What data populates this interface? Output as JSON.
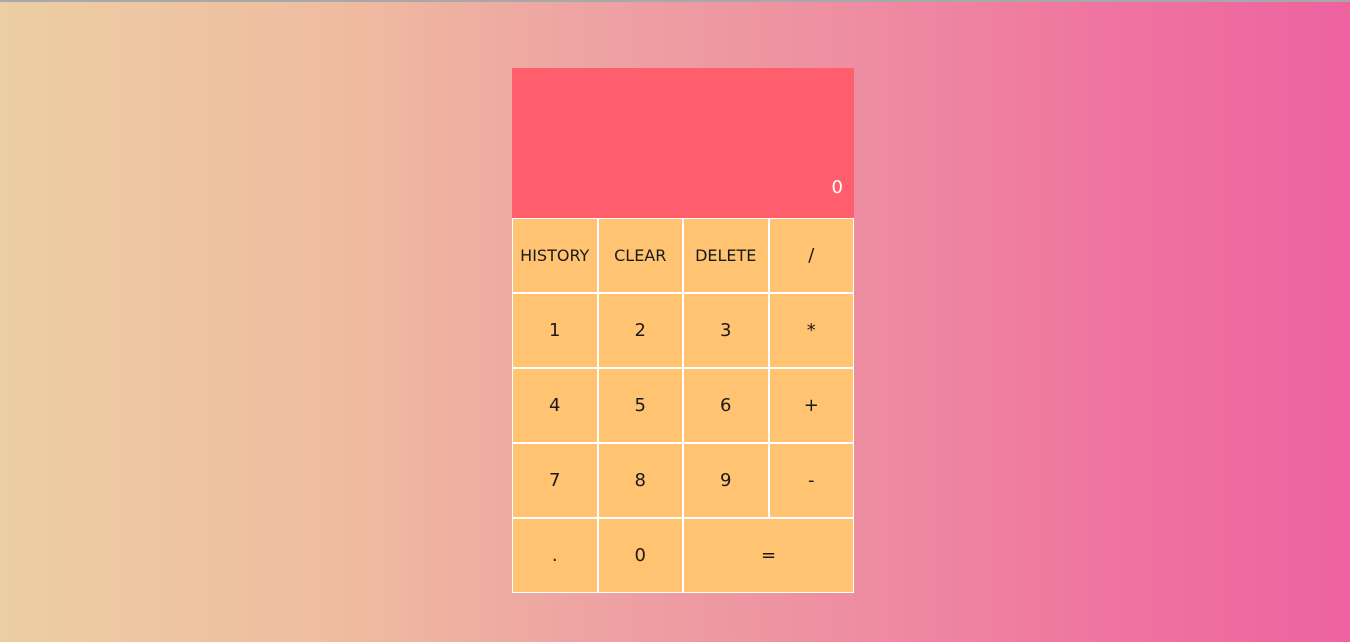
{
  "colors": {
    "display_bg": "#ff5f6d",
    "key_bg": "#ffc372",
    "border": "#ffffff",
    "gradient_left": "#eccea3",
    "gradient_right": "#ee62a0"
  },
  "display": {
    "value": "0"
  },
  "keys": {
    "history": "HISTORY",
    "clear": "CLEAR",
    "delete": "DELETE",
    "divide": "/",
    "one": "1",
    "two": "2",
    "three": "3",
    "multiply": "*",
    "four": "4",
    "five": "5",
    "six": "6",
    "plus": "+",
    "seven": "7",
    "eight": "8",
    "nine": "9",
    "minus": "-",
    "decimal": ".",
    "zero": "0",
    "equals": "="
  }
}
